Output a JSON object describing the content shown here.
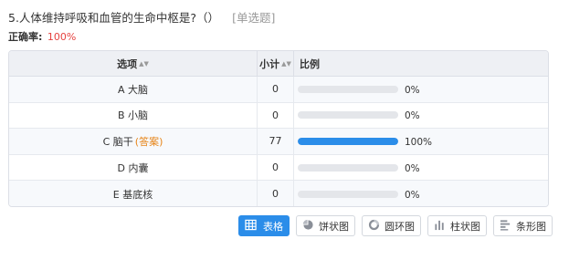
{
  "question": {
    "title": "5.人体维持呼吸和血管的生命中枢是?（）",
    "type": "[单选题]"
  },
  "accuracy": {
    "label": "正确率:",
    "value": "100%"
  },
  "table": {
    "headers": {
      "option": "选项",
      "count": "小计",
      "ratio": "比例"
    },
    "rows": [
      {
        "option": "A 大脑",
        "answer_tag": "",
        "count": "0",
        "percent_label": "0%",
        "fraction": 0
      },
      {
        "option": "B 小脑",
        "answer_tag": "",
        "count": "0",
        "percent_label": "0%",
        "fraction": 0
      },
      {
        "option": "C 脑干",
        "answer_tag": "(答案)",
        "count": "77",
        "percent_label": "100%",
        "fraction": 1.0
      },
      {
        "option": "D 内囊",
        "answer_tag": "",
        "count": "0",
        "percent_label": "0%",
        "fraction": 0
      },
      {
        "option": "E 基底核",
        "answer_tag": "",
        "count": "0",
        "percent_label": "0%",
        "fraction": 0
      }
    ]
  },
  "view_buttons": [
    {
      "label": "表格",
      "icon": "table-icon",
      "active": true
    },
    {
      "label": "饼状图",
      "icon": "pie-chart-icon",
      "active": false
    },
    {
      "label": "圆环图",
      "icon": "donut-chart-icon",
      "active": false
    },
    {
      "label": "柱状图",
      "icon": "bar-chart-icon",
      "active": false
    },
    {
      "label": "条形图",
      "icon": "horizontal-bar-chart-icon",
      "active": false
    }
  ],
  "colors": {
    "accent": "#2b8de9",
    "accuracy": "#e64340",
    "answer_tag": "#e7861b",
    "bar_track": "#e4e6ea"
  }
}
